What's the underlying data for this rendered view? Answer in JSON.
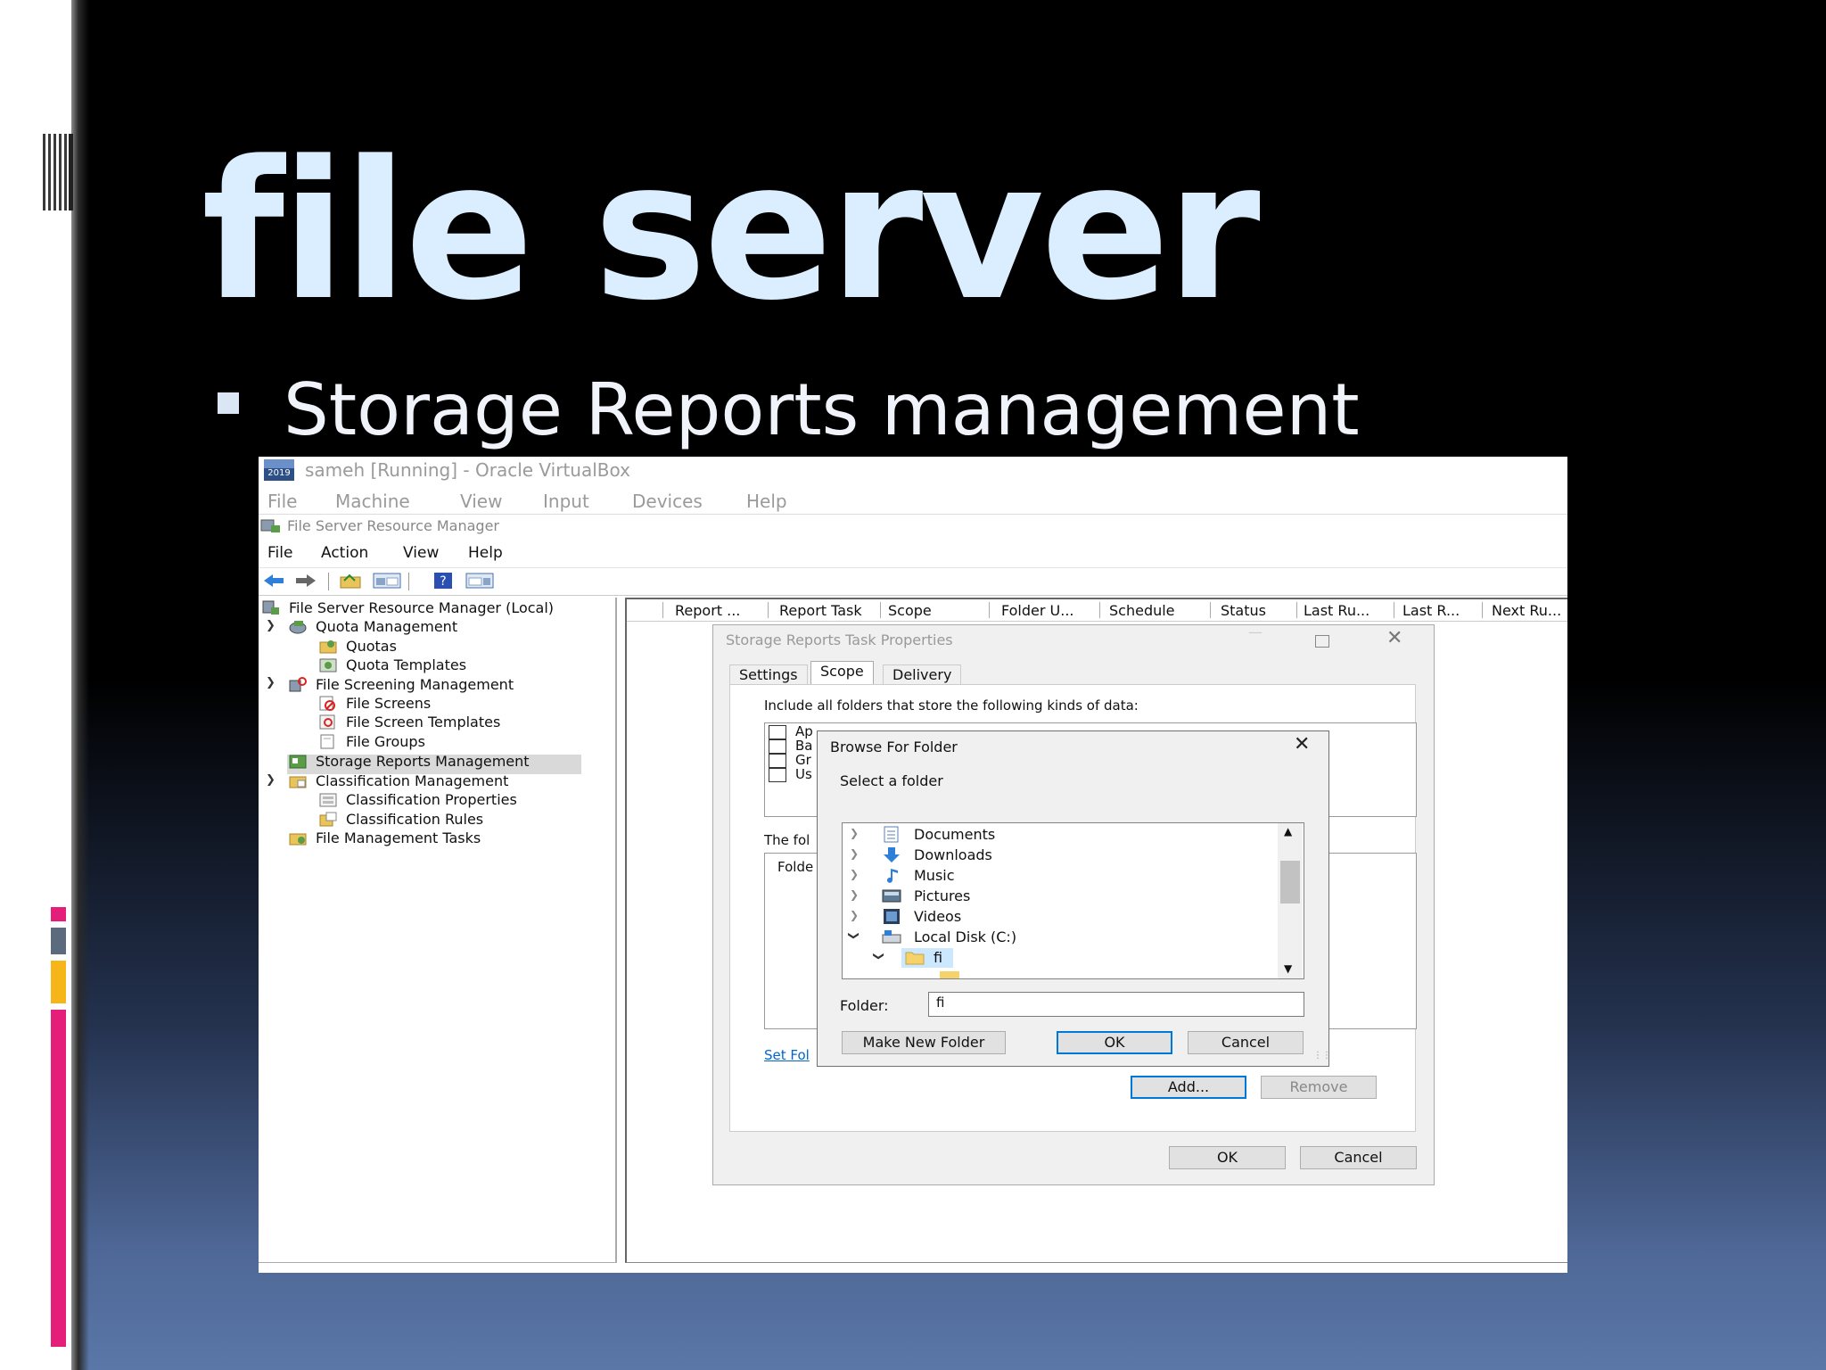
{
  "slide": {
    "title": "file server",
    "bullet_text": "Storage Reports management"
  },
  "virtualbox": {
    "window_title": "sameh [Running] - Oracle VirtualBox",
    "icon_text": "2019",
    "menu": [
      "File",
      "Machine",
      "View",
      "Input",
      "Devices",
      "Help"
    ]
  },
  "fsrm": {
    "window_title": "File Server Resource Manager",
    "menu": [
      "File",
      "Action",
      "View",
      "Help"
    ],
    "tree": [
      {
        "label": "File Server Resource Manager (Local)",
        "icon": "server-icon"
      },
      {
        "label": "Quota Management",
        "icon": "quota-management-icon"
      },
      {
        "label": "Quotas",
        "icon": "quotas-icon"
      },
      {
        "label": "Quota Templates",
        "icon": "quota-templates-icon"
      },
      {
        "label": "File Screening Management",
        "icon": "file-screening-icon"
      },
      {
        "label": "File Screens",
        "icon": "file-screens-icon"
      },
      {
        "label": "File Screen Templates",
        "icon": "file-screen-templates-icon"
      },
      {
        "label": "File Groups",
        "icon": "file-groups-icon"
      },
      {
        "label": "Storage Reports Management",
        "icon": "storage-reports-icon"
      },
      {
        "label": "Classification Management",
        "icon": "classification-icon"
      },
      {
        "label": "Classification Properties",
        "icon": "classification-properties-icon"
      },
      {
        "label": "Classification Rules",
        "icon": "classification-rules-icon"
      },
      {
        "label": "File Management Tasks",
        "icon": "file-management-tasks-icon"
      }
    ],
    "columns": [
      "Report ...",
      "Report Task",
      "Scope",
      "Folder U...",
      "Schedule",
      "Status",
      "Last Ru...",
      "Last R...",
      "Next Ru..."
    ]
  },
  "properties_dialog": {
    "title": "Storage Reports Task Properties",
    "tabs": [
      "Settings",
      "Scope",
      "Delivery"
    ],
    "active_tab": "Scope",
    "include_label": "Include all folders that store the following kinds of data:",
    "checkbox_partial": [
      "Ap",
      "Ba",
      "Gr",
      "Us"
    ],
    "folders_label_partial": "The fol",
    "folder_col_partial": "Folde",
    "set_folder_link_partial": "Set Fol",
    "add_button": "Add...",
    "remove_button": "Remove",
    "ok_button": "OK",
    "cancel_button": "Cancel"
  },
  "browse_dialog": {
    "title": "Browse For Folder",
    "instruction": "Select a folder",
    "items": [
      {
        "label": "Documents",
        "icon": "documents-icon"
      },
      {
        "label": "Downloads",
        "icon": "downloads-icon"
      },
      {
        "label": "Music",
        "icon": "music-icon"
      },
      {
        "label": "Pictures",
        "icon": "pictures-icon"
      },
      {
        "label": "Videos",
        "icon": "videos-icon"
      },
      {
        "label": "Local Disk (C:)",
        "icon": "local-disk-icon"
      },
      {
        "label": "fi",
        "icon": "folder-icon"
      }
    ],
    "folder_label": "Folder:",
    "folder_value": "fi",
    "make_new_folder_button": "Make New Folder",
    "ok_button": "OK",
    "cancel_button": "Cancel"
  },
  "colors": {
    "title_text": "#dbeeff",
    "selection_blue": "#cce8ff",
    "accent_blue": "#0078d7",
    "deco_pink": "#e41e79",
    "deco_yellow": "#f6b619",
    "deco_gray": "#5b6b7d"
  }
}
